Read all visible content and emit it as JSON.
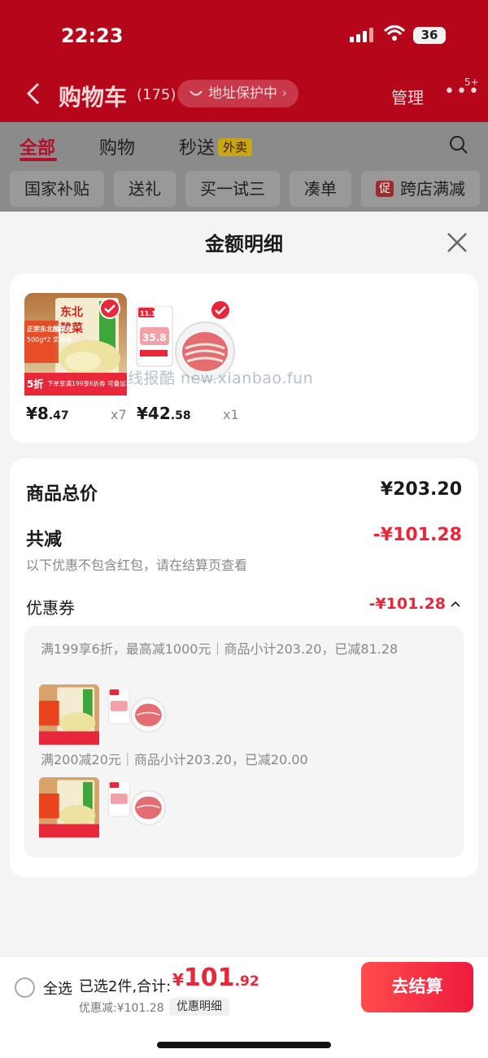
{
  "status_bar": {
    "time": "22:23",
    "battery": "36"
  },
  "nav": {
    "title": "购物车",
    "count": "(175)",
    "address_pill": "地址保护中",
    "manage": "管理",
    "more_badge": "5+"
  },
  "tabs": [
    {
      "label": "全部",
      "active": true
    },
    {
      "label": "购物",
      "active": false
    },
    {
      "label": "秒送",
      "active": false,
      "tag": "外卖"
    }
  ],
  "chips": [
    {
      "label": "国家补贴"
    },
    {
      "label": "送礼"
    },
    {
      "label": "买一试三"
    },
    {
      "label": "凑单"
    },
    {
      "label": "跨店满减",
      "tag": "促"
    }
  ],
  "sheet": {
    "title": "金额明细",
    "watermark": "线报酷 new.xianbao.fun",
    "products": [
      {
        "price_int": "8",
        "price_dec": ".47",
        "qty": "x7",
        "image_text": {
          "top": "东北",
          "middle": "酸菜",
          "side": "正宗东北酸菜丝",
          "spec": "500g*2 实惠装",
          "discount": "5折",
          "promo": "下单享满199享6折券 可叠加200-20"
        }
      },
      {
        "price_int": "42",
        "price_dec": ".58",
        "qty": "x1",
        "image_text": {
          "badge": "11.11",
          "price": "35.8"
        }
      }
    ],
    "summary": {
      "total_label": "商品总价",
      "total_value": "¥203.20",
      "reduce_label": "共减",
      "reduce_value": "-¥101.28",
      "note": "以下优惠不包含红包，请在结算页查看",
      "coupon_label": "优惠券",
      "coupon_value": "-¥101.28",
      "coupons": [
        {
          "text": "满199享6折，最高减1000元｜商品小计203.20，已减81.28"
        },
        {
          "text": "满200减20元｜商品小计203.20，已减20.00"
        }
      ]
    }
  },
  "footer": {
    "select_all": "全选",
    "selected_text": "已选2件,合计:",
    "currency": "¥",
    "total_int": "101",
    "total_dec": ".92",
    "discount_text": "优惠减:¥101.28",
    "detail_chip": "优惠明细",
    "checkout": "去结算"
  },
  "colors": {
    "accent": "#e8283a",
    "header_red": "#b5061a"
  }
}
